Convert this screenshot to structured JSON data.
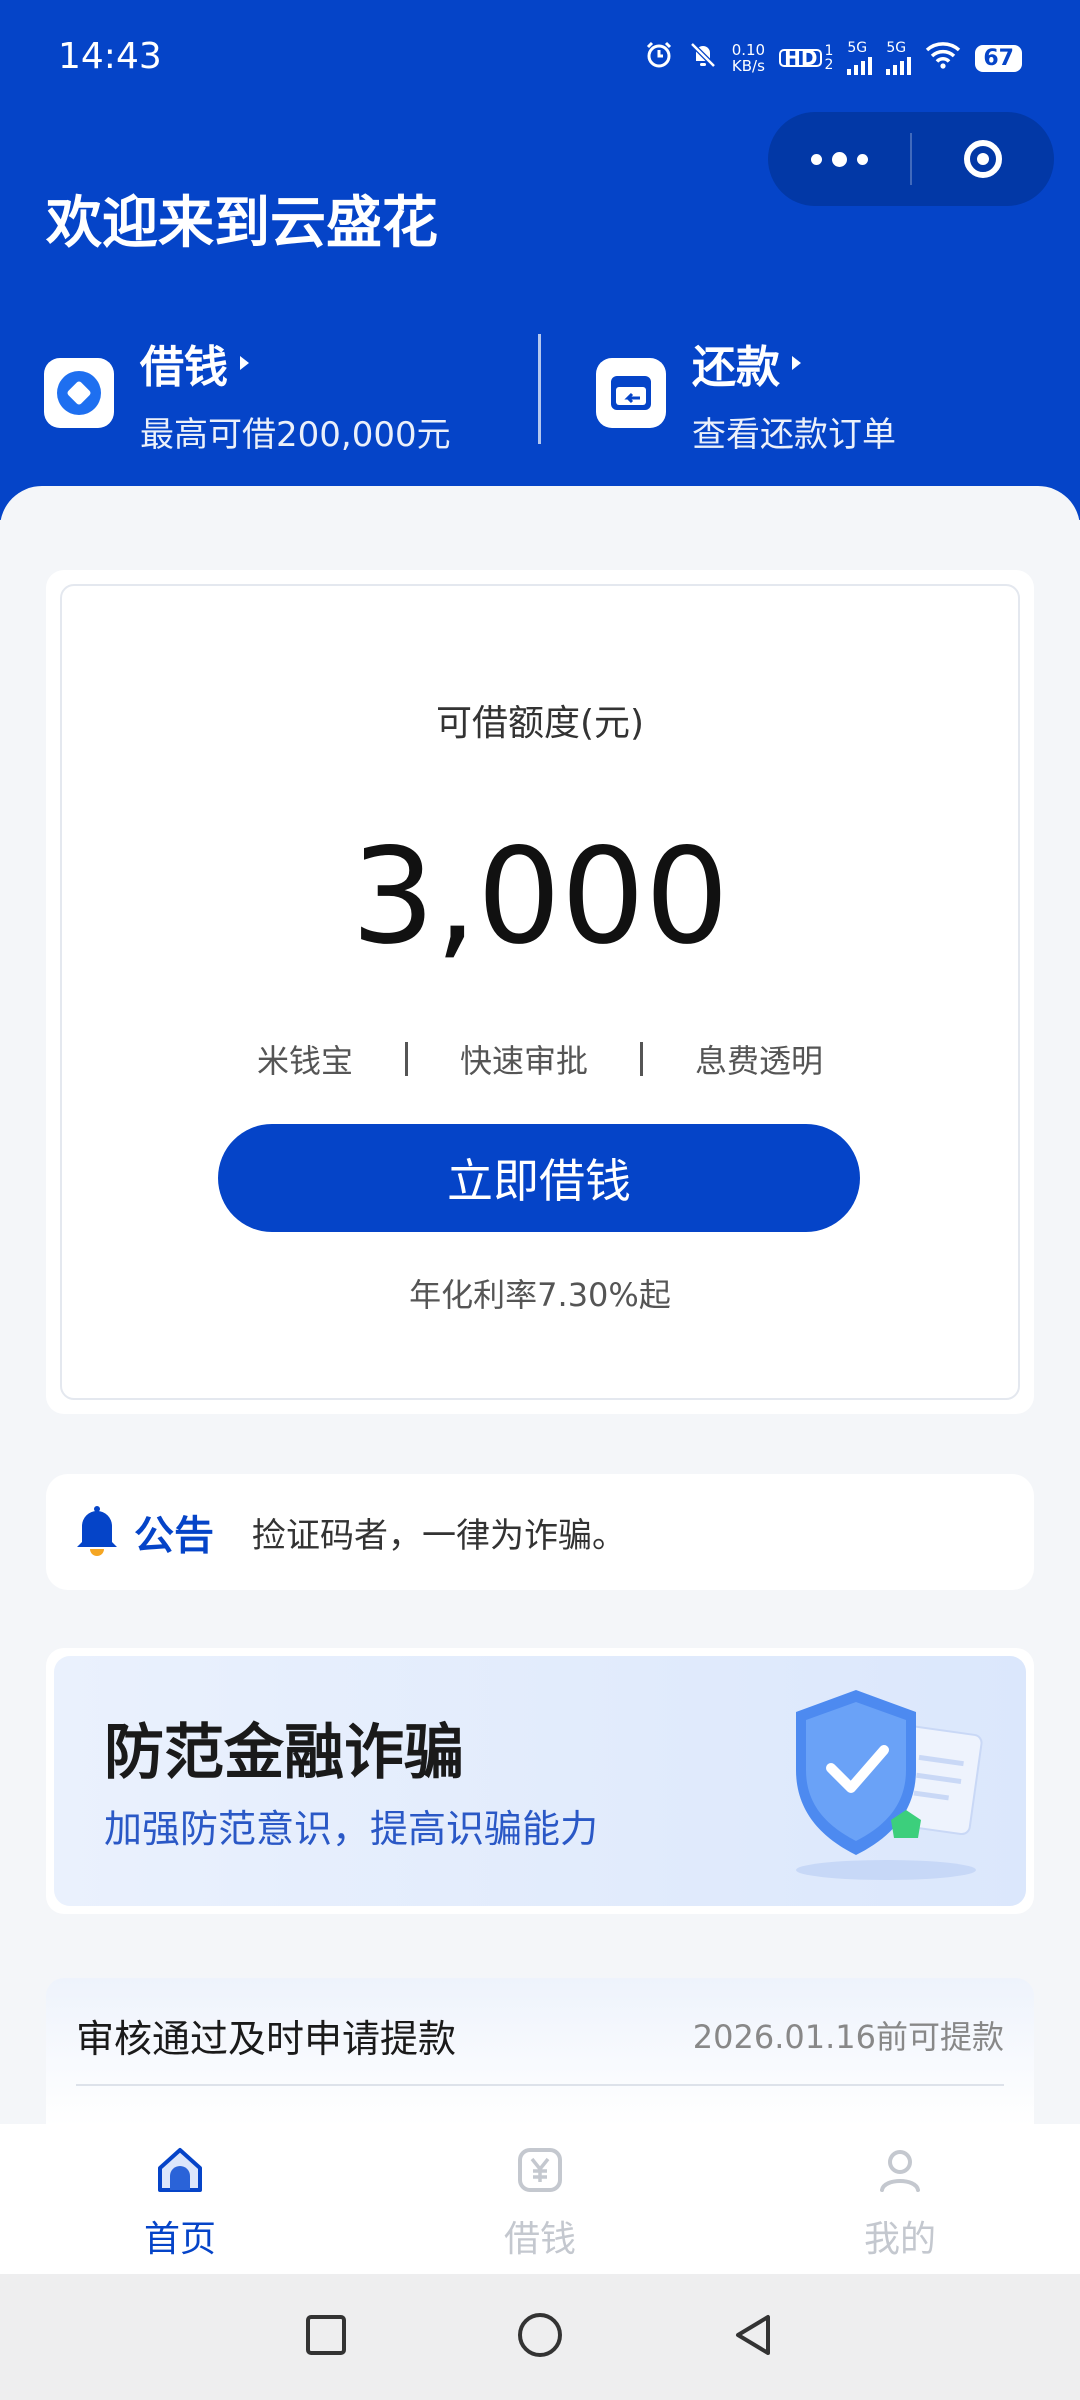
{
  "status_bar": {
    "time": "14:43",
    "net_speed_value": "0.10",
    "net_speed_unit": "KB/s",
    "hd_label": "HD",
    "sim1": "1",
    "sim2": "2",
    "net1": "5G",
    "net2": "5G",
    "battery": "67"
  },
  "header": {
    "welcome": "欢迎来到云盛花",
    "borrow": {
      "title": "借钱",
      "subtitle": "最高可借200,000元"
    },
    "repay": {
      "title": "还款",
      "subtitle": "查看还款订单"
    }
  },
  "credit": {
    "label": "可借额度(元)",
    "amount": "3,000",
    "features": [
      "米钱宝",
      "快速审批",
      "息费透明"
    ],
    "button": "立即借钱",
    "rate": "年化利率7.30%起"
  },
  "notice": {
    "label": "公告",
    "text": "捡证码者，一律为诈骗。"
  },
  "banner": {
    "title": "防范金融诈骗",
    "subtitle": "加强防范意识，提高识骗能力"
  },
  "review": {
    "title": "审核通过及时申请提款",
    "date": "2026.01.16前可提款"
  },
  "tabbar": {
    "items": [
      {
        "label": "首页",
        "icon": "home-icon",
        "active": true
      },
      {
        "label": "借钱",
        "icon": "yuan-icon",
        "active": false
      },
      {
        "label": "我的",
        "icon": "user-icon",
        "active": false
      }
    ]
  },
  "colors": {
    "brand_blue": "#0544c8",
    "background": "#f4f6f9",
    "inactive_tab": "#c4c8cf"
  }
}
